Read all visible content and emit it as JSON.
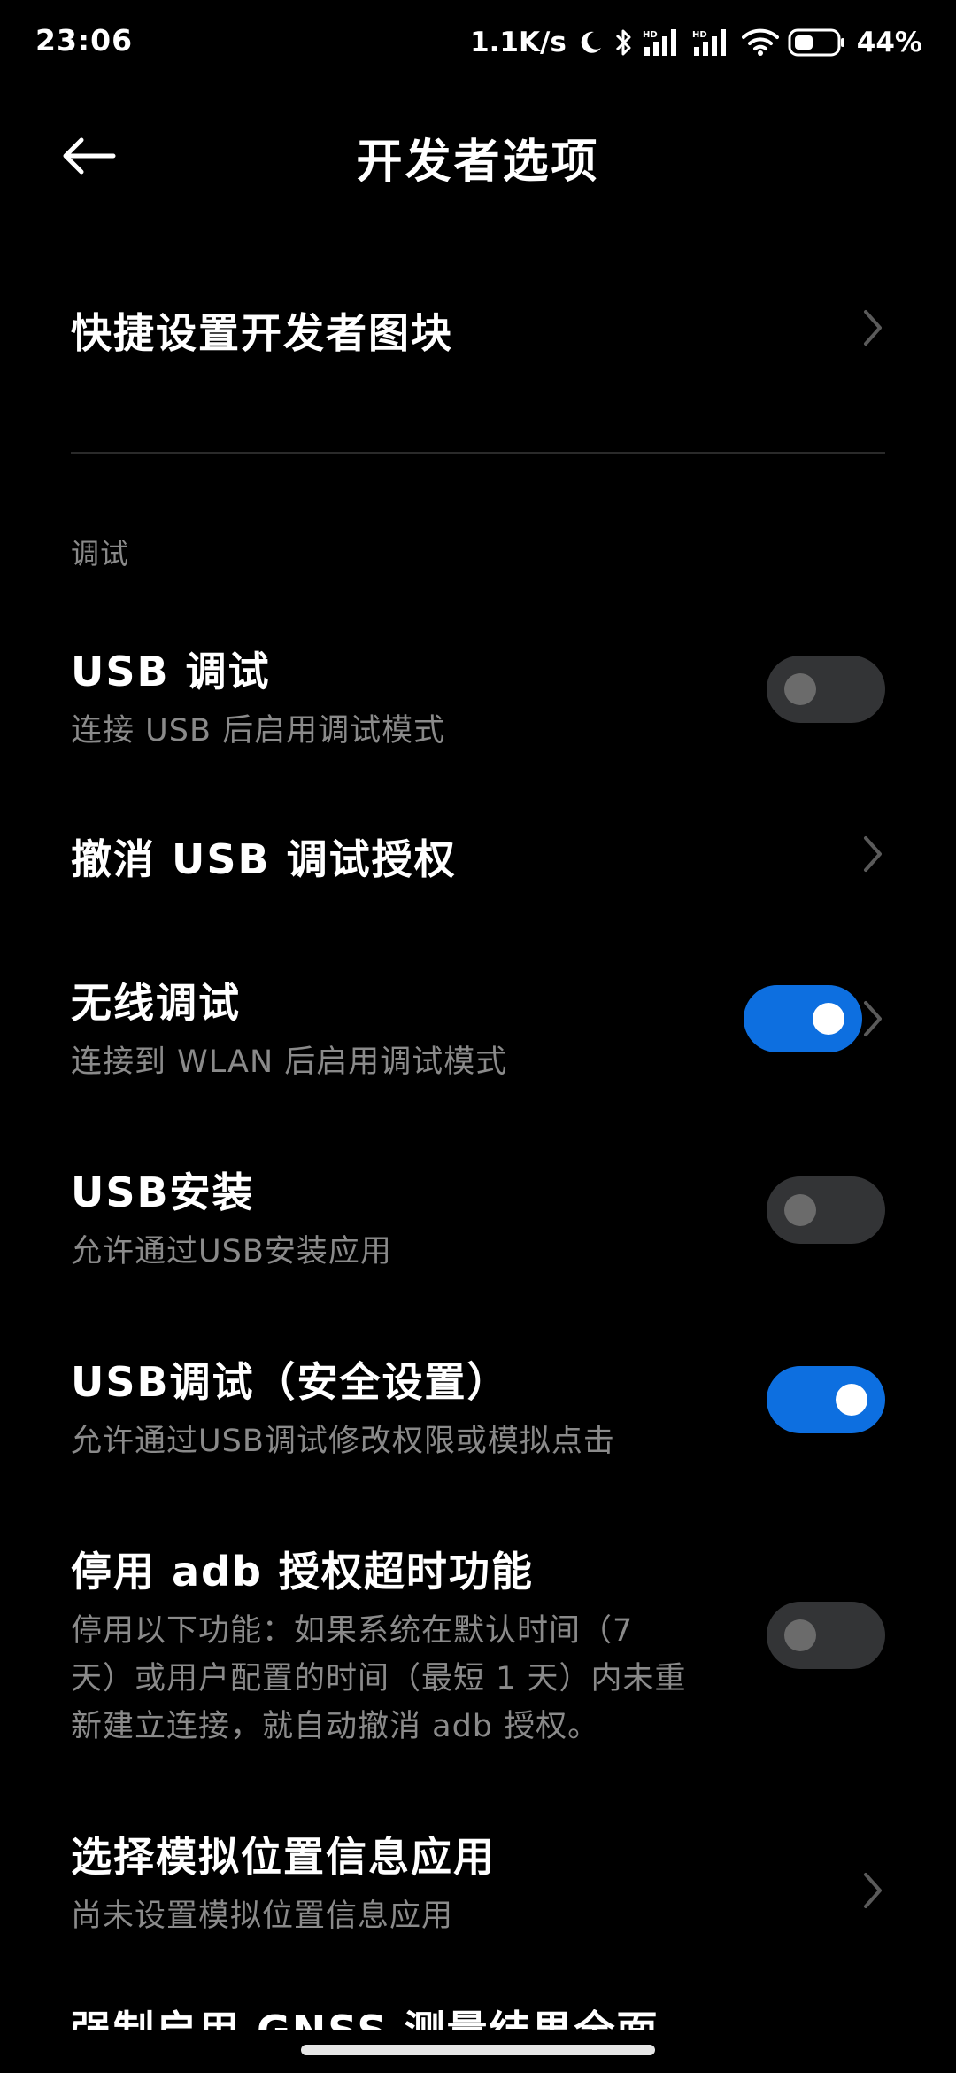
{
  "status_bar": {
    "time": "23:06",
    "net_speed": "1.1K/s",
    "battery_pct": "44%",
    "icons": [
      "moon-icon",
      "bluetooth-icon",
      "signal-hd-icon",
      "signal-hd-icon",
      "wifi-icon",
      "battery-icon"
    ]
  },
  "header": {
    "title": "开发者选项",
    "back_icon": "arrow-left-icon"
  },
  "tiles": {
    "title": "快捷设置开发者图块"
  },
  "section": {
    "label": "调试"
  },
  "items": [
    {
      "title": "USB 调试",
      "subtitle": "连接 USB 后启用调试模式",
      "toggle": "off"
    },
    {
      "title": "撤消 USB 调试授权",
      "chevron": true
    },
    {
      "title": "无线调试",
      "subtitle": "连接到 WLAN 后启用调试模式",
      "toggle": "on",
      "chevron": true
    },
    {
      "title": "USB安装",
      "subtitle": "允许通过USB安装应用",
      "toggle": "off"
    },
    {
      "title": "USB调试（安全设置）",
      "subtitle": "允许通过USB调试修改权限或模拟点击",
      "toggle": "on"
    },
    {
      "title": "停用 adb 授权超时功能",
      "subtitle_lines": [
        "停用以下功能：如果系统在默认时间（7",
        "天）或用户配置的时间（最短 1 天）内未重",
        "新建立连接，就自动撤消 adb 授权。"
      ],
      "toggle": "off"
    },
    {
      "title": "选择模拟位置信息应用",
      "subtitle": "尚未设置模拟位置信息应用",
      "chevron": true
    },
    {
      "title": "强制启用 GNSS 测量结果全面"
    }
  ],
  "colors": {
    "background": "#000000",
    "accent": "#0d6fe0",
    "subtitle": "#8a8a8a",
    "toggle_off": "#333436"
  }
}
